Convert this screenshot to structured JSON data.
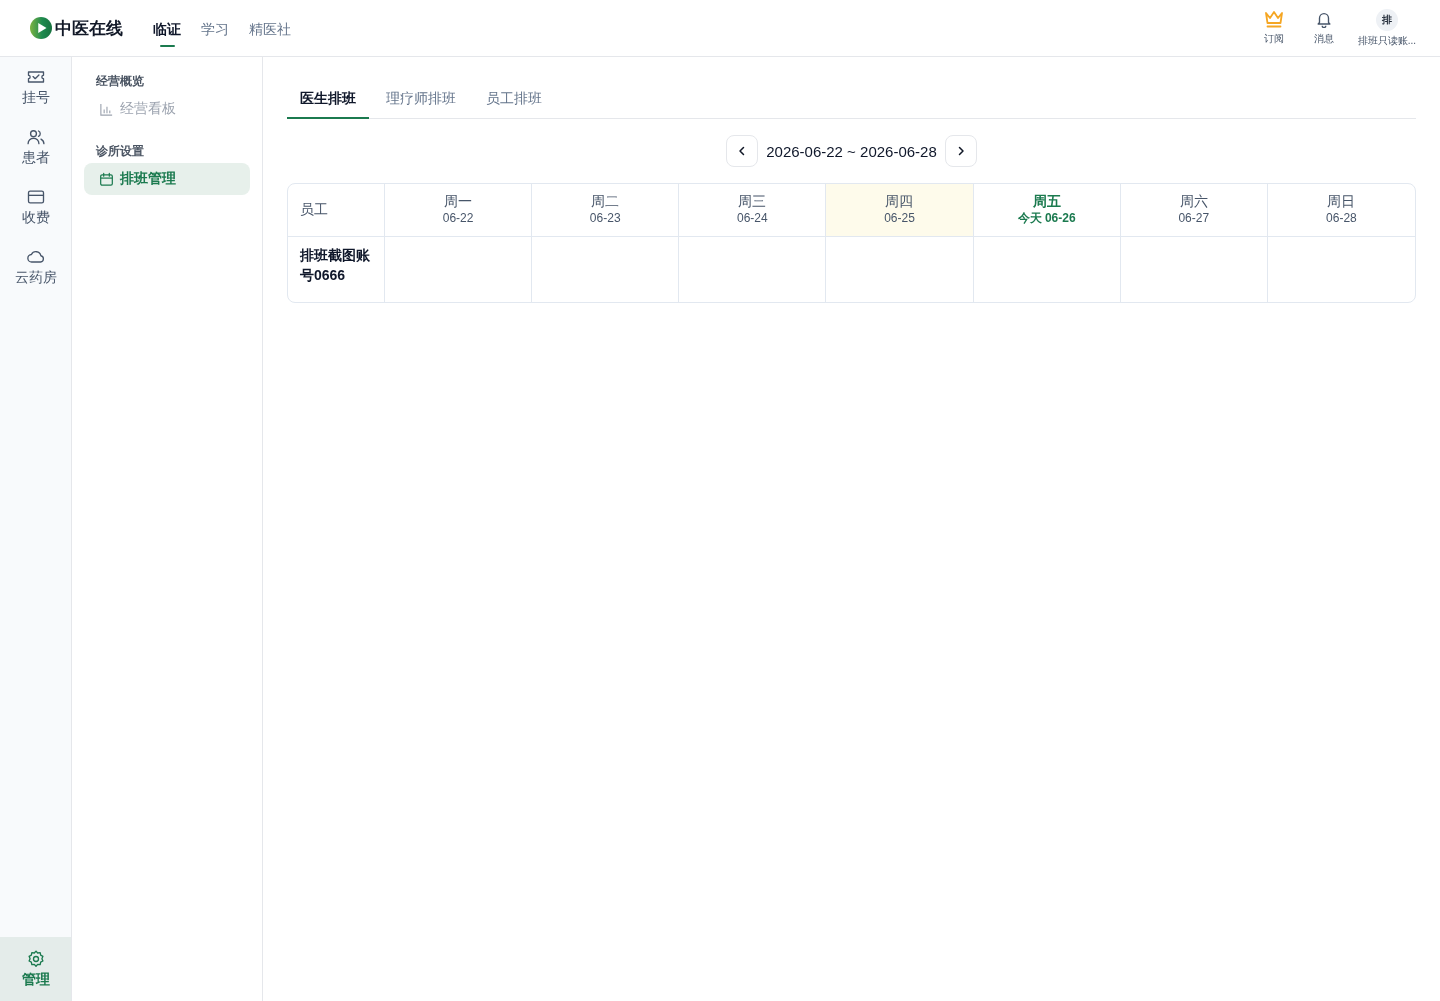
{
  "app": {
    "logo": "中医在线"
  },
  "top_nav": [
    {
      "label": "临证",
      "selected": true
    },
    {
      "label": "学习",
      "selected": false
    },
    {
      "label": "精医社",
      "selected": false
    }
  ],
  "header_actions": [
    {
      "kind": "subscribe",
      "label": "订阅"
    },
    {
      "kind": "messages",
      "label": "消息"
    }
  ],
  "user": {
    "avatar_text": "排",
    "name": "排班只读账..."
  },
  "rail": {
    "items": [
      {
        "kind": "registration",
        "label": "挂号",
        "selected": false
      },
      {
        "kind": "patients",
        "label": "患者",
        "selected": false
      },
      {
        "kind": "billing",
        "label": "收费",
        "selected": false
      },
      {
        "kind": "pharmacy",
        "label": "云药房",
        "selected": false
      }
    ],
    "footer": {
      "kind": "settings",
      "label": "管理",
      "selected": true
    }
  },
  "sidebar": {
    "groups": [
      {
        "title": "经营概览",
        "items": [
          {
            "kind": "dashboard",
            "label": "经营看板",
            "selected": false,
            "disabled": true
          }
        ]
      },
      {
        "title": "诊所设置",
        "items": [
          {
            "kind": "schedule",
            "label": "排班管理",
            "selected": true,
            "disabled": false
          }
        ]
      }
    ]
  },
  "tabs": [
    {
      "label": "医生排班",
      "selected": true
    },
    {
      "label": "理疗师排班",
      "selected": false
    },
    {
      "label": "员工排班",
      "selected": false
    }
  ],
  "date_range": "2026-06-22 ~ 2026-06-28",
  "schedule": {
    "employee_header": "员工",
    "days": [
      {
        "weekday": "周一",
        "date": "06-22",
        "highlighted": false,
        "today": false
      },
      {
        "weekday": "周二",
        "date": "06-23",
        "highlighted": false,
        "today": false
      },
      {
        "weekday": "周三",
        "date": "06-24",
        "highlighted": false,
        "today": false
      },
      {
        "weekday": "周四",
        "date": "06-25",
        "highlighted": true,
        "today": false
      },
      {
        "weekday": "周五",
        "date": "今天 06-26",
        "highlighted": false,
        "today": true
      },
      {
        "weekday": "周六",
        "date": "06-27",
        "highlighted": false,
        "today": false
      },
      {
        "weekday": "周日",
        "date": "06-28",
        "highlighted": false,
        "today": false
      }
    ],
    "rows": [
      {
        "employee": "排班截图账号0666"
      }
    ]
  }
}
